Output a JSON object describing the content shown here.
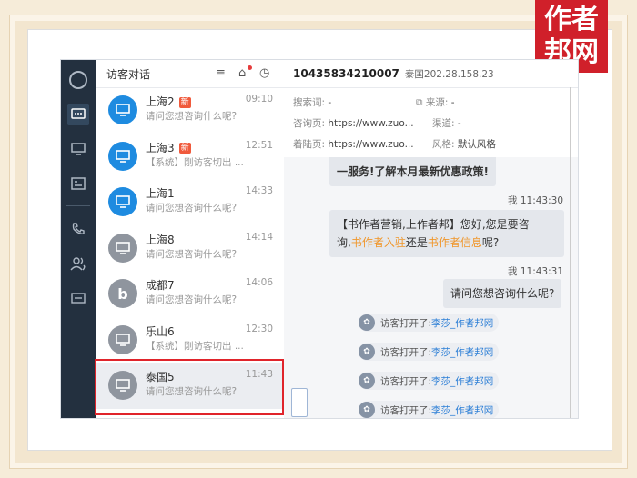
{
  "watermark": {
    "line1": "作者",
    "line2": "邦网"
  },
  "convo_list": {
    "title": "访客对话",
    "items": [
      {
        "name": "上海2",
        "badge": "新",
        "msg": "请问您想咨询什么呢?",
        "time": "09:10",
        "color": "#1e8be0"
      },
      {
        "name": "上海3",
        "badge": "新",
        "msg": "【系统】刚访客切出 ...",
        "time": "12:51",
        "color": "#1e8be0"
      },
      {
        "name": "上海1",
        "badge": "",
        "msg": "请问您想咨询什么呢?",
        "time": "14:33",
        "color": "#1e8be0"
      },
      {
        "name": "上海8",
        "badge": "",
        "msg": "请问您想咨询什么呢?",
        "time": "14:14",
        "color": "#8f959e"
      },
      {
        "name": "成都7",
        "badge": "",
        "msg": "请问您想咨询什么呢?",
        "time": "14:06",
        "color": "#8f959e"
      },
      {
        "name": "乐山6",
        "badge": "",
        "msg": "【系统】刚访客切出 ...",
        "time": "12:30",
        "color": "#8f959e"
      },
      {
        "name": "泰国5",
        "badge": "",
        "msg": "请问您想咨询什么呢?",
        "time": "11:43",
        "color": "#8f959e"
      }
    ]
  },
  "detail": {
    "visitor_id": "10435834210007",
    "visitor_ip": "泰国202.28.158.23",
    "search_label": "搜索词:",
    "search_value": "-",
    "source_label": "来源:",
    "source_value": "-",
    "consult_label": "咨询页:",
    "consult_value": "https://www.zuo...",
    "channel_label": "渠道:",
    "channel_value": "-",
    "landing_label": "着陆页:",
    "landing_value": "https://www.zuo...",
    "style_label": "风格:",
    "style_value": "默认风格"
  },
  "chat": {
    "top_text": "一服务!了解本月最新优惠政策!",
    "ts1": "我 11:43:30",
    "msg1_a": "【书作者营销,上作者邦】您好,您是要咨",
    "msg1_b": "询,",
    "msg1_link1": "书作者入驻",
    "msg1_c": "还是",
    "msg1_link2": "书作者信息",
    "msg1_d": "呢?",
    "ts2": "我 11:43:31",
    "msg2": "请问您想咨询什么呢?",
    "sys_prefix": "访客打开了:",
    "sys_link": "李莎_作者邦网"
  }
}
